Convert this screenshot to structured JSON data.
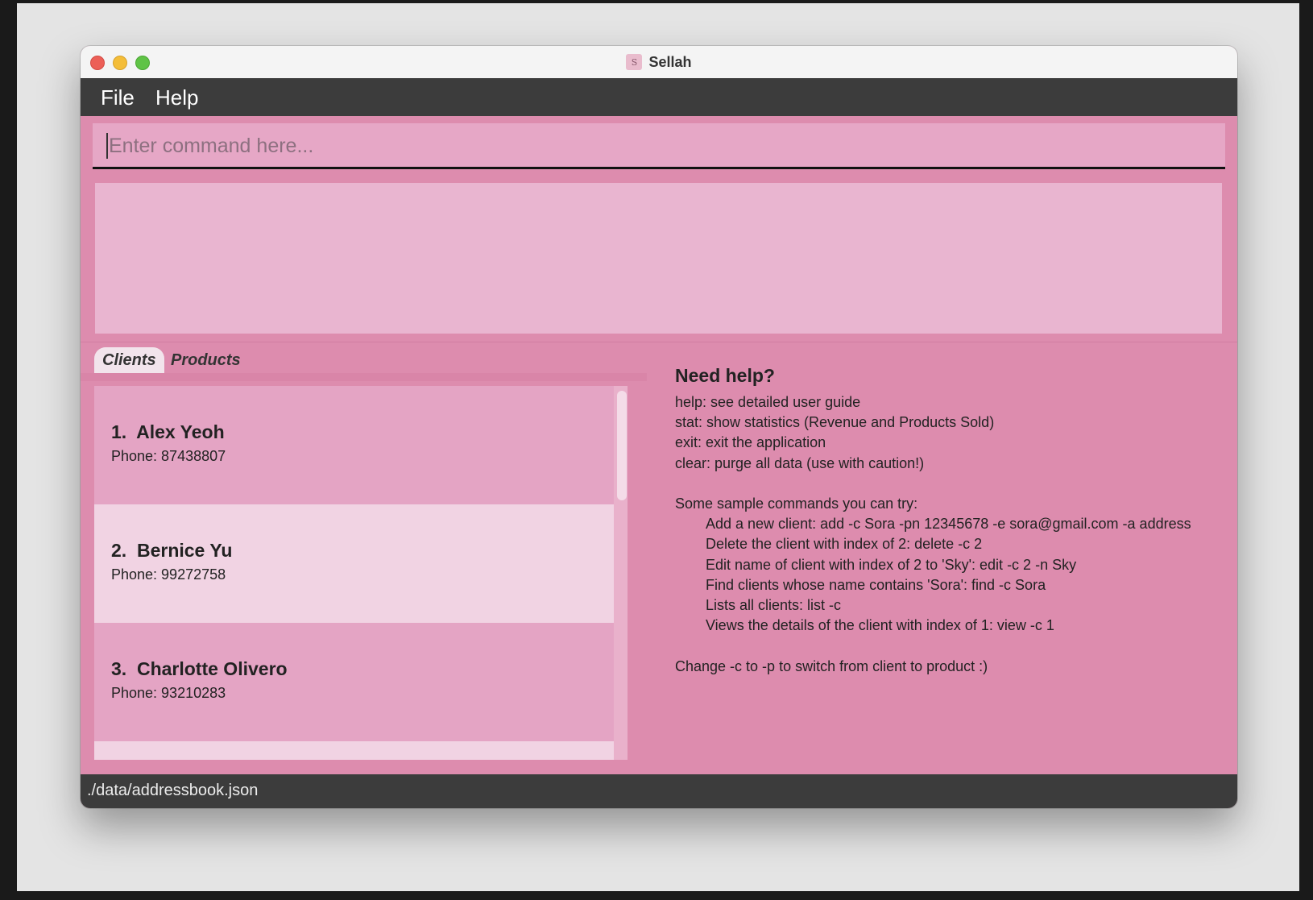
{
  "window": {
    "title": "Sellah",
    "app_icon_letter": "S"
  },
  "menubar": {
    "items": [
      "File",
      "Help"
    ]
  },
  "command": {
    "placeholder": "Enter command here...",
    "value": ""
  },
  "result": {
    "text": ""
  },
  "tabs": [
    "Clients",
    "Products"
  ],
  "clients": [
    {
      "index": "1.",
      "name": "Alex Yeoh",
      "phone": "Phone: 87438807"
    },
    {
      "index": "2.",
      "name": "Bernice Yu",
      "phone": "Phone: 99272758"
    },
    {
      "index": "3.",
      "name": "Charlotte Olivero",
      "phone": "Phone: 93210283"
    }
  ],
  "help": {
    "title": "Need help?",
    "basic": [
      "help: see detailed user guide",
      "stat: show statistics (Revenue and Products Sold)",
      "exit: exit the application",
      "clear: purge all data (use with caution!)"
    ],
    "samples_heading": "Some sample commands you can try:",
    "samples": [
      "Add a new client: add -c Sora -pn 12345678 -e sora@gmail.com -a address",
      "Delete the client with index of 2: delete -c 2",
      "Edit name of client with index of 2 to 'Sky': edit -c 2 -n Sky",
      "Find clients whose name contains 'Sora': find -c Sora",
      "Lists all clients: list -c",
      "Views the details of the client with index of 1: view -c 1"
    ],
    "footer": "Change -c to -p to switch from client to product :)"
  },
  "statusbar": {
    "path": "./data/addressbook.json"
  },
  "colors": {
    "accent_pink": "#dd8cae",
    "input_pink": "#e6a7c6",
    "result_pink": "#e9b5d0",
    "row_light": "#f1d3e3",
    "bar_dark": "#3c3c3c"
  }
}
